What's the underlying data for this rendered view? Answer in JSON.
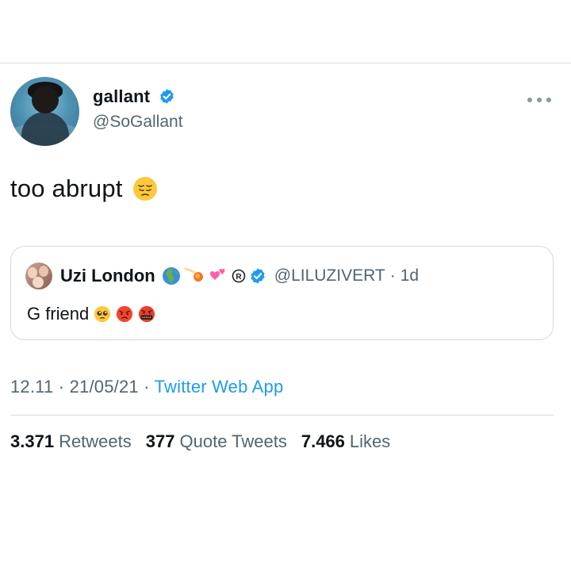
{
  "tweet": {
    "author": {
      "display_name": "gallant",
      "handle": "@SoGallant",
      "verified": true
    },
    "text": "too abrupt",
    "text_emoji": "pensive-face",
    "quoted": {
      "display_name": "Uzi London",
      "name_emojis": [
        "globe-europe-africa",
        "comet",
        "two-hearts",
        "registered-sign"
      ],
      "verified": true,
      "handle": "@LILUZIVERT",
      "separator": "·",
      "age": "1d",
      "text": "G friend",
      "text_emojis": [
        "pleading-face",
        "angry-face",
        "face-with-symbols-on-mouth"
      ]
    },
    "meta": {
      "time": "12.11",
      "sep1": "·",
      "date": "21/05/21",
      "sep2": "·",
      "source": "Twitter Web App"
    },
    "stats": {
      "retweets_count": "3.371",
      "retweets_label": "Retweets",
      "quotes_count": "377",
      "quotes_label": "Quote Tweets",
      "likes_count": "7.466",
      "likes_label": "Likes"
    }
  },
  "colors": {
    "accent": "#1d9bf0",
    "text_primary": "#0f1419",
    "text_secondary": "#536471",
    "divider": "#d8dde1"
  }
}
